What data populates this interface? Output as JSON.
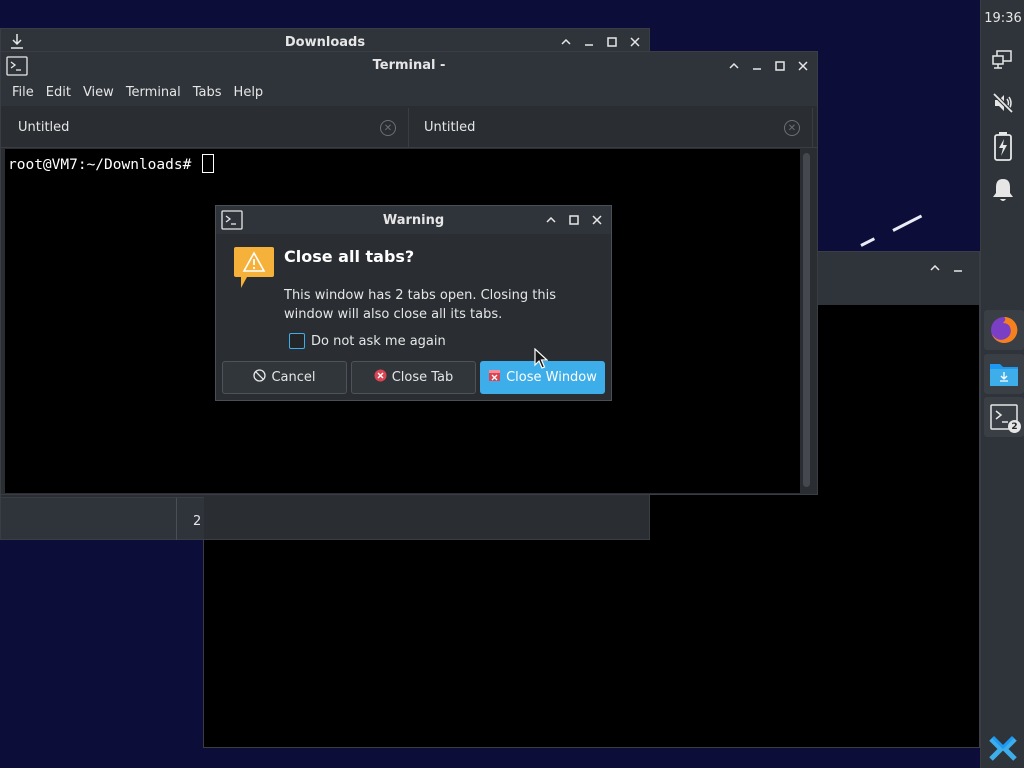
{
  "desktop": {
    "background_color": "#0d0d3a"
  },
  "downloads_window": {
    "title": "Downloads",
    "status_number": "2"
  },
  "terminal_window": {
    "title": "Terminal -",
    "menu": [
      "File",
      "Edit",
      "View",
      "Terminal",
      "Tabs",
      "Help"
    ],
    "tabs": [
      {
        "label": "Untitled"
      },
      {
        "label": "Untitled"
      }
    ],
    "prompt": "root@VM7:~/Downloads# "
  },
  "warning_dialog": {
    "title": "Warning",
    "heading": "Close all tabs?",
    "message": "This window has 2 tabs open. Closing this window will also close all its tabs.",
    "checkbox_label": "Do not ask me again",
    "checkbox_checked": false,
    "buttons": {
      "cancel": "Cancel",
      "close_tab": "Close Tab",
      "close_window": "Close Window"
    }
  },
  "panel": {
    "clock": "19:36",
    "tray_icons": [
      "network-icon",
      "volume-muted-icon",
      "battery-charging-icon",
      "notifications-icon"
    ],
    "tasks": [
      {
        "name": "firefox-icon"
      },
      {
        "name": "file-manager-icon"
      },
      {
        "name": "terminal-icon",
        "badge": "2"
      }
    ],
    "accent_color": "#3daee9"
  }
}
